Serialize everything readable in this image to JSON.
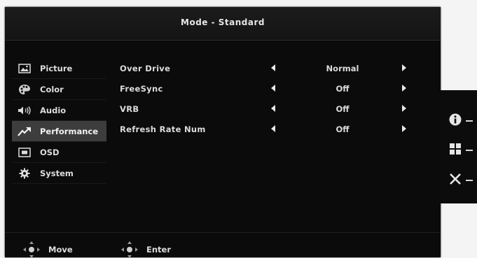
{
  "header": {
    "title": "Mode - Standard"
  },
  "menu": {
    "items": [
      {
        "label": "Picture",
        "icon": "picture-icon",
        "active": false
      },
      {
        "label": "Color",
        "icon": "palette-icon",
        "active": false
      },
      {
        "label": "Audio",
        "icon": "speaker-icon",
        "active": false
      },
      {
        "label": "Performance",
        "icon": "performance-icon",
        "active": true
      },
      {
        "label": "OSD",
        "icon": "osd-icon",
        "active": false
      },
      {
        "label": "System",
        "icon": "gear-icon",
        "active": false
      }
    ]
  },
  "settings": {
    "rows": [
      {
        "label": "Over Drive",
        "value": "Normal"
      },
      {
        "label": "FreeSync",
        "value": "Off"
      },
      {
        "label": "VRB",
        "value": "Off"
      },
      {
        "label": "Refresh Rate Num",
        "value": "Off"
      }
    ]
  },
  "footer": {
    "move_label": "Move",
    "enter_label": "Enter"
  },
  "side_buttons": [
    "info-icon",
    "grid-icon",
    "close-icon"
  ],
  "colors": {
    "osd_background": "#0b0b0b",
    "active_item": "#3d3d3d",
    "text": "#dcdcdc"
  }
}
